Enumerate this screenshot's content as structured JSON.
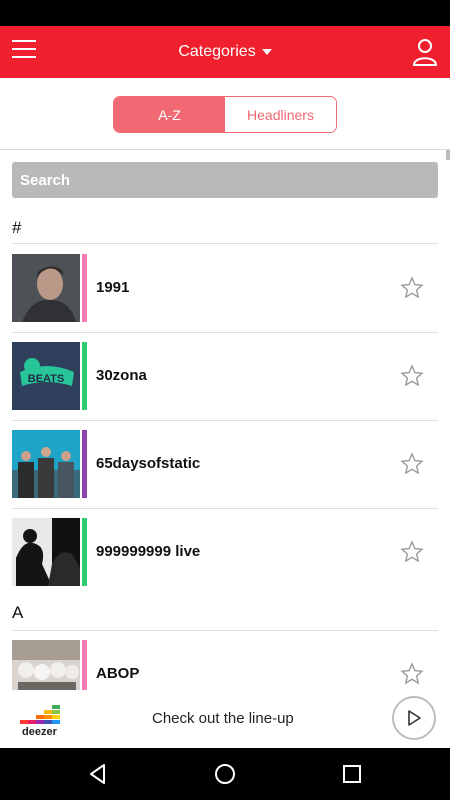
{
  "app_bar": {
    "title": "Categories",
    "menu_icon": "hamburger-icon",
    "profile_icon": "person-icon",
    "color": "#ef1f2e"
  },
  "tabs": [
    {
      "label": "A-Z",
      "active": true
    },
    {
      "label": "Headliners",
      "active": false
    }
  ],
  "search": {
    "placeholder": "Search"
  },
  "sections": [
    {
      "header": "#",
      "artists": [
        {
          "name": "1991",
          "accent": "#f47ab1"
        },
        {
          "name": "30zona",
          "accent": "#2ecc71"
        },
        {
          "name": "65daysofstatic",
          "accent": "#8e44ad"
        },
        {
          "name": "999999999 live",
          "accent": "#2ecc71"
        }
      ]
    },
    {
      "header": "A",
      "artists": [
        {
          "name": "ABOP",
          "accent": "#f47ab1"
        }
      ]
    }
  ],
  "banner": {
    "logo_text": "deezer",
    "text": "Check out the line-up",
    "play_icon": "play-icon"
  },
  "system_nav": {
    "back_icon": "back-icon",
    "home_icon": "home-icon",
    "recents_icon": "recents-icon"
  }
}
